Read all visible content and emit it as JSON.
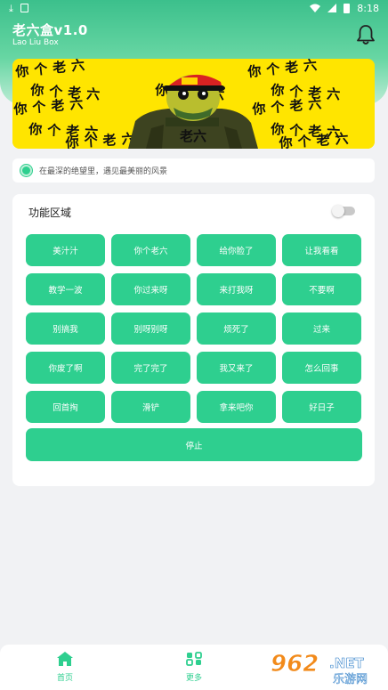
{
  "status_bar": {
    "time": "8:18"
  },
  "header": {
    "title": "老六盒v1.0",
    "subtitle": "Lao Liu Box",
    "bell_icon": "bell-icon"
  },
  "banner": {
    "phrase": "你个老六",
    "shirt_text": "老六",
    "background_color": "#ffe500"
  },
  "notice": {
    "text": "在最深的绝望里，遇见最美丽的风景"
  },
  "panel": {
    "title": "功能区域",
    "toggle_on": false,
    "buttons": [
      "美汁汁",
      "你个老六",
      "给你脸了",
      "让我看看",
      "教学一波",
      "你过来呀",
      "来打我呀",
      "不要啊",
      "别搞我",
      "别呀别呀",
      "烦死了",
      "过来",
      "你废了啊",
      "完了完了",
      "我又来了",
      "怎么回事",
      "回首掏",
      "滑铲",
      "拿来吧你",
      "好日子"
    ],
    "stop_label": "停止"
  },
  "bottom_nav": {
    "items": [
      {
        "label": "首页",
        "icon": "home-icon"
      },
      {
        "label": "更多",
        "icon": "more-icon"
      }
    ]
  },
  "watermark": {
    "logo": "962",
    "suffix": ".NET",
    "caption": "乐游网"
  },
  "colors": {
    "accent": "#2ecf8f",
    "header": "#3cc08c"
  }
}
